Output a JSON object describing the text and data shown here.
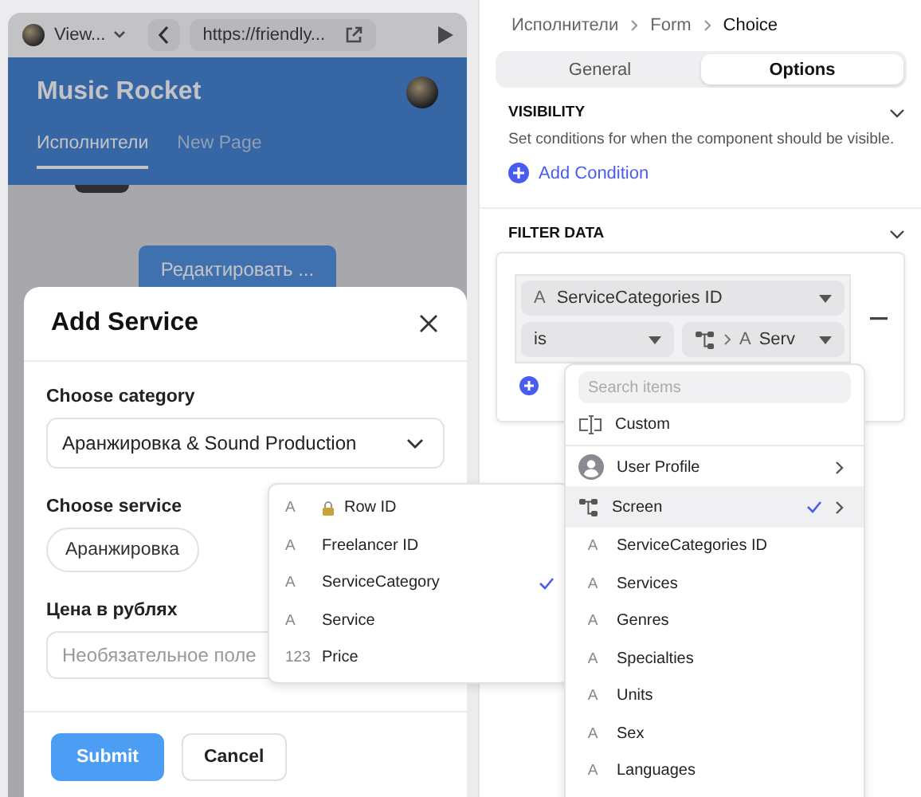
{
  "preview": {
    "view_menu": "View...",
    "url": "https://friendly...",
    "app_title": "Music Rocket",
    "nav_tabs": [
      {
        "label": "Исполнители",
        "selected": true
      },
      {
        "label": "New Page",
        "selected": false
      }
    ],
    "edit_button": "Редактировать ..."
  },
  "modal": {
    "title": "Add Service",
    "fields": [
      {
        "kind": "select",
        "label": "Choose category",
        "value": "Аранжировка & Sound Production"
      },
      {
        "kind": "chips",
        "label": "Choose service",
        "options": [
          "Аранжировка"
        ]
      },
      {
        "kind": "text",
        "label": "Цена в рублях",
        "placeholder": "Необязательное поле"
      }
    ],
    "buttons": [
      {
        "label": "Submit",
        "kind": "primary"
      },
      {
        "label": "Cancel",
        "kind": "secondary"
      }
    ]
  },
  "column_menu": {
    "items": [
      {
        "icon": "A",
        "label": "Row ID",
        "locked": true,
        "selected": false
      },
      {
        "icon": "A",
        "label": "Freelancer ID",
        "locked": false,
        "selected": false
      },
      {
        "icon": "A",
        "label": "ServiceCategory",
        "locked": false,
        "selected": true
      },
      {
        "icon": "A",
        "label": "Service",
        "locked": false,
        "selected": false
      },
      {
        "icon": "123",
        "label": "Price",
        "locked": false,
        "selected": false
      }
    ]
  },
  "inspector": {
    "breadcrumb": [
      "Исполнители",
      "Form",
      "Choice"
    ],
    "tabs": [
      {
        "label": "General",
        "selected": false
      },
      {
        "label": "Options",
        "selected": true
      }
    ],
    "visibility": {
      "title": "VISIBILITY",
      "description": "Set conditions for when the component should be visible.",
      "add_label": "Add Condition"
    },
    "filter": {
      "title": "FILTER DATA",
      "field_icon": "A",
      "field": "ServiceCategories ID",
      "operator": "is",
      "value_icon": "A",
      "value": "Serv"
    }
  },
  "source_menu": {
    "placeholder": "Search items",
    "items": [
      {
        "kind": "custom",
        "label": "Custom",
        "submenu": false,
        "selected": false
      },
      {
        "kind": "user",
        "label": "User Profile",
        "submenu": true,
        "selected": false
      },
      {
        "kind": "screen",
        "label": "Screen",
        "submenu": true,
        "selected": true
      },
      {
        "kind": "text",
        "icon": "A",
        "label": "ServiceCategories ID",
        "submenu": false,
        "selected": false
      },
      {
        "kind": "text",
        "icon": "A",
        "label": "Services",
        "submenu": false,
        "selected": false
      },
      {
        "kind": "text",
        "icon": "A",
        "label": "Genres",
        "submenu": false,
        "selected": false
      },
      {
        "kind": "text",
        "icon": "A",
        "label": "Specialties",
        "submenu": false,
        "selected": false
      },
      {
        "kind": "text",
        "icon": "A",
        "label": "Units",
        "submenu": false,
        "selected": false
      },
      {
        "kind": "text",
        "icon": "A",
        "label": "Sex",
        "submenu": false,
        "selected": false
      },
      {
        "kind": "text",
        "icon": "A",
        "label": "Languages",
        "submenu": false,
        "selected": false
      }
    ]
  }
}
